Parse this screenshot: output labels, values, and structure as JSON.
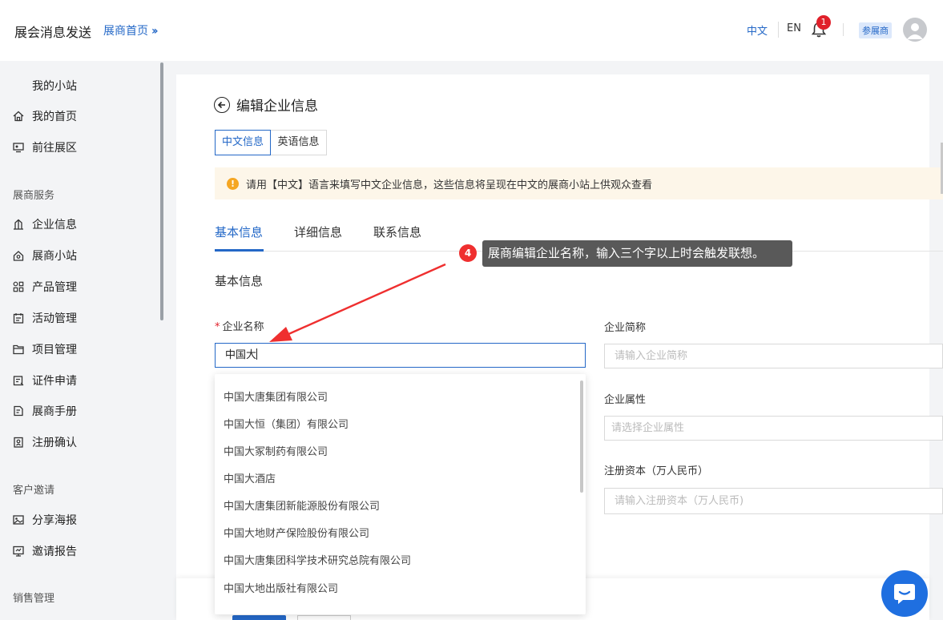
{
  "header": {
    "app_title": "展会消息发送",
    "home_link": "展商首页",
    "lang_zh": "中文",
    "lang_en": "EN",
    "notification_count": "1",
    "role_badge": "参展商"
  },
  "sidebar": {
    "items_top": [
      {
        "label": "我的小站",
        "icon": ""
      },
      {
        "label": "我的首页",
        "icon": "home-icon"
      },
      {
        "label": "前往展区",
        "icon": "monitor-icon"
      }
    ],
    "group1": "展商服务",
    "items_service": [
      {
        "label": "企业信息",
        "icon": "building-icon"
      },
      {
        "label": "展商小站",
        "icon": "house-icon"
      },
      {
        "label": "产品管理",
        "icon": "grid-icon"
      },
      {
        "label": "活动管理",
        "icon": "calendar-icon"
      },
      {
        "label": "项目管理",
        "icon": "folder-icon"
      },
      {
        "label": "证件申请",
        "icon": "badge-icon"
      },
      {
        "label": "展商手册",
        "icon": "manual-icon"
      },
      {
        "label": "注册确认",
        "icon": "register-icon"
      }
    ],
    "group2": "客户邀请",
    "items_invite": [
      {
        "label": "分享海报",
        "icon": "image-icon"
      },
      {
        "label": "邀请报告",
        "icon": "report-icon"
      }
    ],
    "group3": "销售管理"
  },
  "page": {
    "title": "编辑企业信息",
    "lang_tabs": [
      "中文信息",
      "英语信息"
    ],
    "notice": "请用【中文】语言来填写中文企业信息，这些信息将呈现在中文的展商小站上供观众查看",
    "tabs": [
      "基本信息",
      "详细信息",
      "联系信息"
    ],
    "section_title": "基本信息",
    "form": {
      "company_name_label": "企业名称",
      "company_name_value": "中国大",
      "short_name_label": "企业简称",
      "short_name_placeholder": "请输入企业简称",
      "attribute_label": "企业属性",
      "attribute_placeholder": "请选择企业属性",
      "capital_label": "注册资本（万人民币）",
      "capital_placeholder": "请输入注册资本（万人民币)"
    },
    "suggestions": [
      "中国大唐集团有限公司",
      "中国大恒（集团）有限公司",
      "中国大冢制药有限公司",
      "中国大酒店",
      "中国大唐集团新能源股份有限公司",
      "中国大地财产保险股份有限公司",
      "中国大唐集团科学技术研究总院有限公司",
      "中国大地出版社有限公司"
    ]
  },
  "guide": {
    "step_number": "4",
    "tooltip": "展商编辑企业名称，输入三个字以上时会触发联想。"
  },
  "colors": {
    "accent": "#2468c7",
    "tooltip_bg": "#595959",
    "step_red": "#ef2f2f",
    "notice_bg": "#fdf6e9"
  }
}
